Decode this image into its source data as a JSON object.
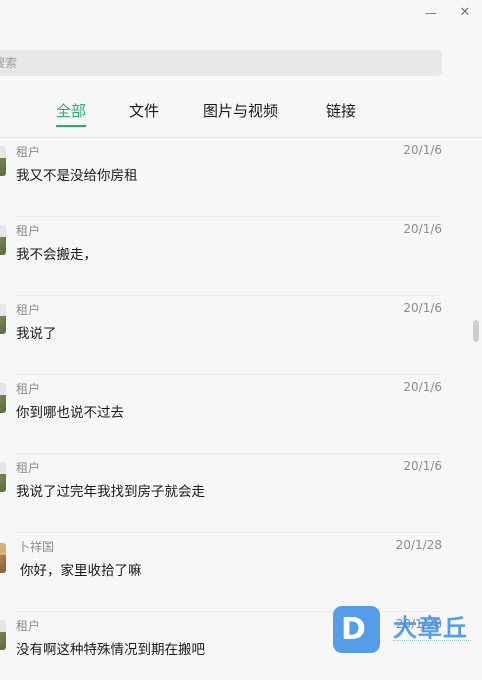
{
  "window": {
    "minimize_glyph": "—",
    "close_glyph": "✕"
  },
  "search": {
    "placeholder": "搜索"
  },
  "tabs": [
    {
      "label": "全部",
      "active": true
    },
    {
      "label": "文件",
      "active": false
    },
    {
      "label": "图片与视频",
      "active": false
    },
    {
      "label": "链接",
      "active": false
    }
  ],
  "messages": [
    {
      "sender": "租户",
      "date": "20/1/6",
      "text": "我又不是没给你房租"
    },
    {
      "sender": "租户",
      "date": "20/1/6",
      "text": "我不会搬走，"
    },
    {
      "sender": "租户",
      "date": "20/1/6",
      "text": "我说了"
    },
    {
      "sender": "租户",
      "date": "20/1/6",
      "text": "你到哪也说不过去"
    },
    {
      "sender": "租户",
      "date": "20/1/6",
      "text": "我说了过完年我找到房子就会走"
    },
    {
      "sender": "卜祥国",
      "date": "20/1/28",
      "text": "你好，家里收拾了嘛"
    },
    {
      "sender": "租户",
      "date": "20/1/28",
      "text": "没有啊这种特殊情况到期在搬吧"
    }
  ],
  "watermark": {
    "badge": "D",
    "text": "大章丘"
  },
  "colors": {
    "accent": "#2aae67",
    "watermark": "#3a8ee6"
  }
}
